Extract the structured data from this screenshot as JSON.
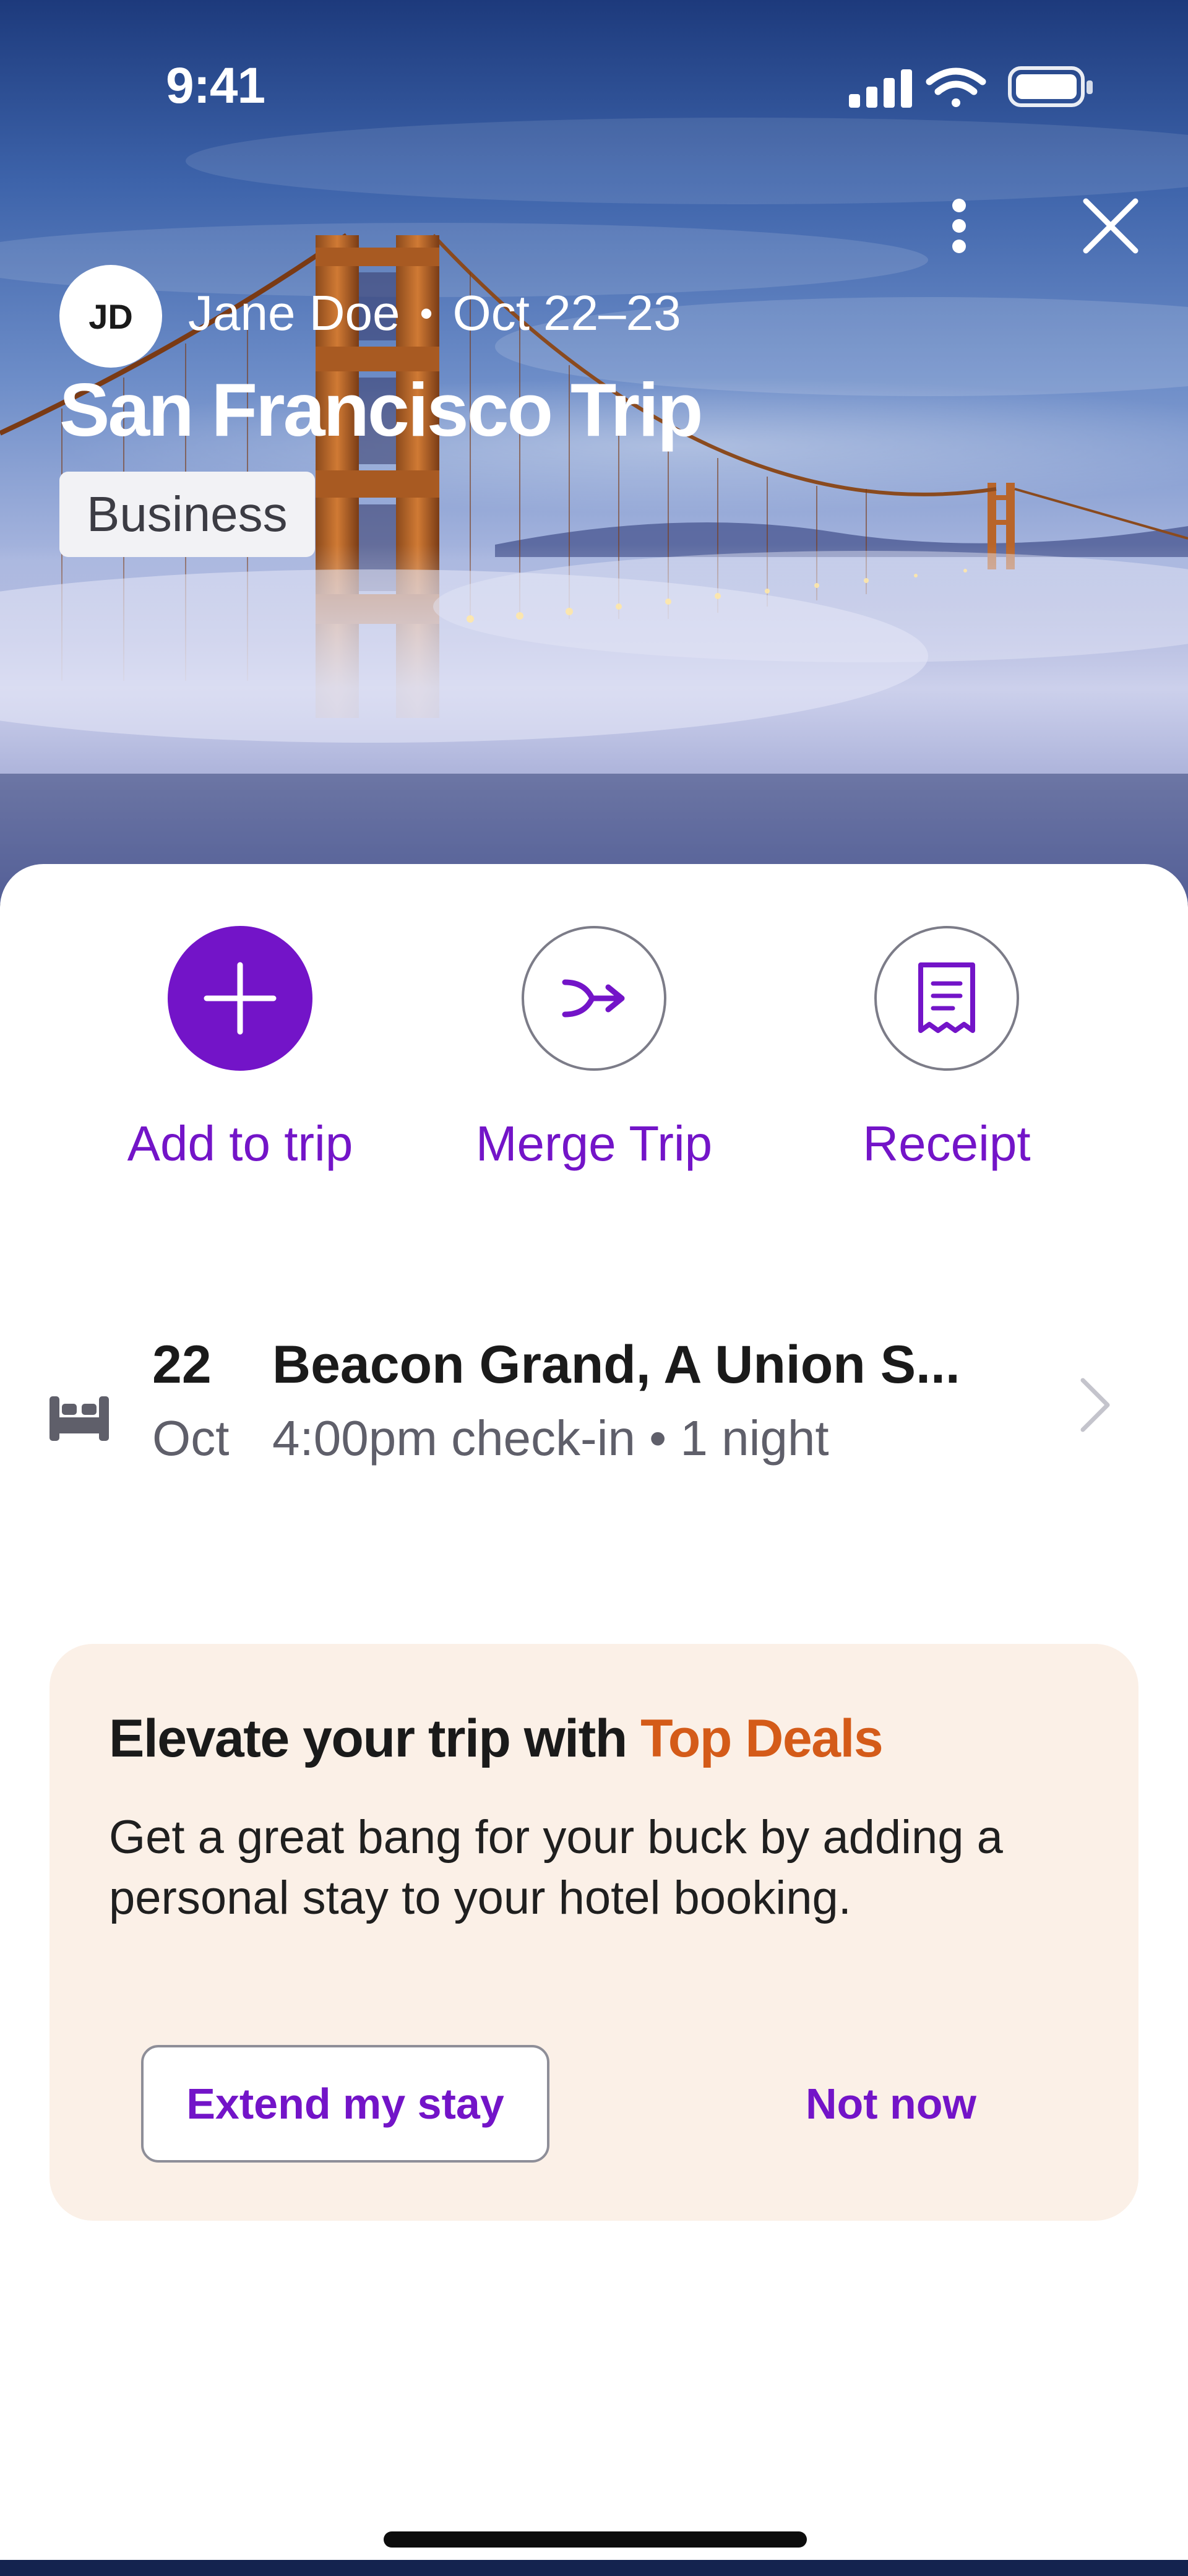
{
  "status_bar": {
    "time": "9:41"
  },
  "hero": {
    "avatar_initials": "JD",
    "traveler_name": "Jane Doe",
    "separator": "•",
    "dates": "Oct 22–23",
    "trip_title": "San Francisco Trip",
    "trip_tag": "Business"
  },
  "quick_actions": [
    {
      "label": "Add to trip",
      "icon": "plus-icon"
    },
    {
      "label": "Merge Trip",
      "icon": "merge-icon"
    },
    {
      "label": "Receipt",
      "icon": "receipt-icon"
    }
  ],
  "booking": {
    "icon": "bed-icon",
    "day": "22",
    "month": "Oct",
    "name": "Beacon Grand, A Union S...",
    "meta": "4:00pm check-in • 1 night"
  },
  "promo": {
    "title_prefix": "Elevate your trip with ",
    "title_accent": "Top Deals",
    "body": "Get a great bang for your buck by adding a personal stay to your hotel booking.",
    "primary_button": "Extend my stay",
    "secondary_button": "Not now"
  },
  "colors": {
    "accent_purple": "#7314c8",
    "promo_orange": "#d45b19",
    "promo_background": "#fbf0e7"
  }
}
